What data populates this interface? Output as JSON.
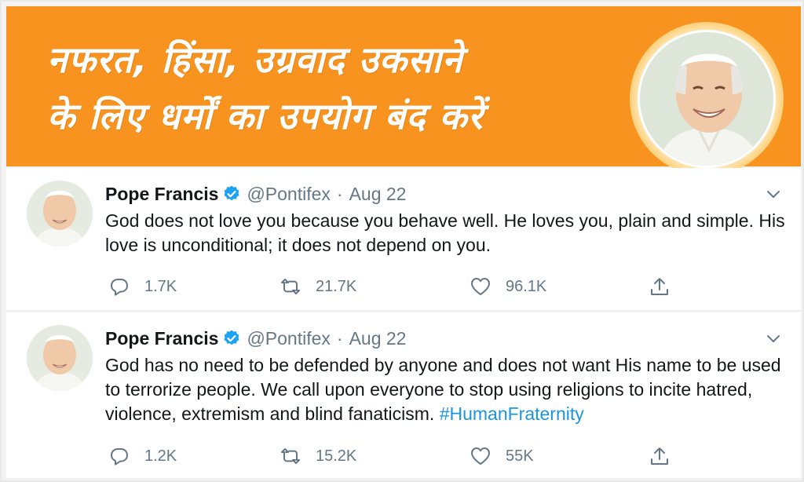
{
  "banner": {
    "line1": "नफरत, हिंसा, उग्रवाद उकसाने",
    "line2": "के लिए धर्मों का उपयोग बंद करें"
  },
  "colors": {
    "banner_orange": "#f7931e",
    "link_blue": "#1b95e0",
    "verified_blue": "#1da1f2",
    "muted_gray": "#657786"
  },
  "tweets": [
    {
      "name": "Pope Francis",
      "handle": "@Pontifex",
      "separator": "·",
      "date": "Aug 22",
      "text": "God does not love you because you behave well. He loves you, plain and simple. His love is unconditional; it does not depend on you.",
      "hashtag": "",
      "replies": "1.7K",
      "retweets": "21.7K",
      "likes": "96.1K"
    },
    {
      "name": "Pope Francis",
      "handle": "@Pontifex",
      "separator": "·",
      "date": "Aug 22",
      "text": "God has no need to be defended by anyone and does not want His name to be used to terrorize people. We call upon everyone to stop using religions to incite hatred, violence, extremism and blind fanaticism.",
      "hashtag": "#HumanFraternity",
      "replies": "1.2K",
      "retweets": "15.2K",
      "likes": "55K"
    }
  ],
  "icons": {
    "verified": "verified-badge-icon",
    "caret": "chevron-down-icon",
    "reply": "reply-icon",
    "retweet": "retweet-icon",
    "like": "heart-icon",
    "share": "share-icon"
  }
}
